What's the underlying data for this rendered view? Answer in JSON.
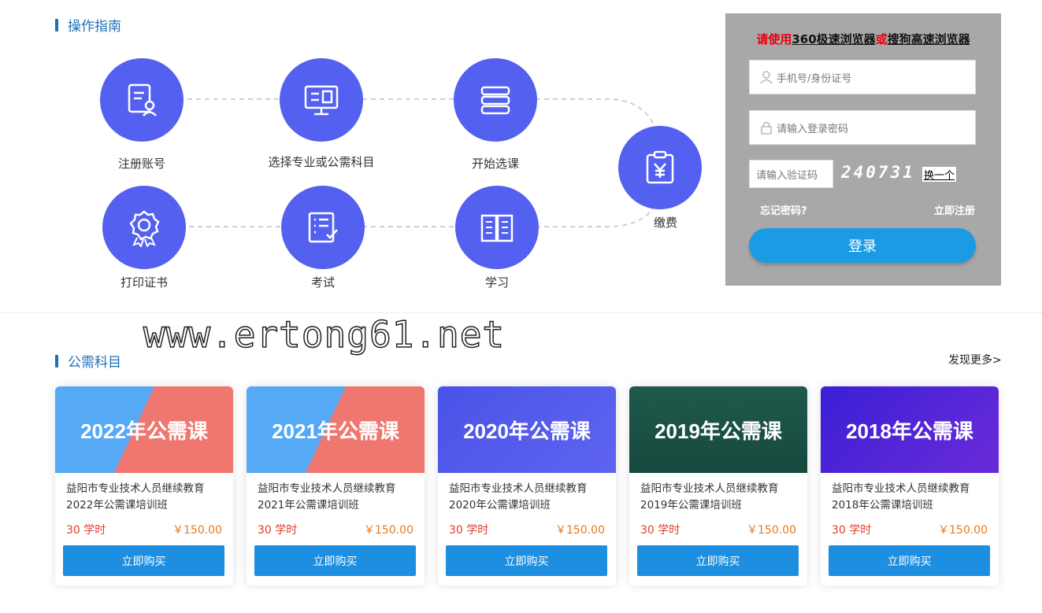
{
  "guide": {
    "title": "操作指南",
    "steps": [
      {
        "label": "注册账号",
        "icon": "register-doc-icon"
      },
      {
        "label": "选择专业或公需科目",
        "icon": "monitor-icon"
      },
      {
        "label": "开始选课",
        "icon": "books-icon"
      },
      {
        "label": "缴费",
        "icon": "clipboard-yen-icon"
      },
      {
        "label": "打印证书",
        "icon": "award-badge-icon"
      },
      {
        "label": "考试",
        "icon": "checklist-icon"
      },
      {
        "label": "学习",
        "icon": "open-book-icon"
      }
    ]
  },
  "login": {
    "note_prefix": "请使用",
    "note_link1": "360极速浏览器",
    "note_mid": "或",
    "note_link2": "搜狗高速浏览器",
    "username_placeholder": "手机号/身份证号",
    "password_placeholder": "请输入登录密码",
    "captcha_placeholder": "请输入验证码",
    "captcha_code": "240731",
    "captcha_swap": "换一个",
    "forgot": "忘记密码?",
    "register": "立即注册",
    "submit": "登录",
    "accent": "#1b9be3"
  },
  "watermark": "www.ertong61.net",
  "courses": {
    "title": "公需科目",
    "more": "发现更多>",
    "items": [
      {
        "banner": "2022年公需课",
        "line1": "益阳市专业技术人员继续教育",
        "line2": "2022年公需课培训班",
        "hours": "30 学时",
        "price": "￥150.00",
        "buy": "立即购买",
        "bg": "linear-gradient(115deg,#56a9f5 0%,#56a9f5 45%,#f0776f 46%,#f0776f 100%)"
      },
      {
        "banner": "2021年公需课",
        "line1": "益阳市专业技术人员继续教育",
        "line2": "2021年公需课培训班",
        "hours": "30 学时",
        "price": "￥150.00",
        "buy": "立即购买",
        "bg": "linear-gradient(115deg,#56a9f5 0%,#56a9f5 45%,#f0776f 46%,#f0776f 100%)"
      },
      {
        "banner": "2020年公需课",
        "line1": "益阳市专业技术人员继续教育",
        "line2": "2020年公需课培训班",
        "hours": "30 学时",
        "price": "￥150.00",
        "buy": "立即购买",
        "bg": "linear-gradient(135deg,#4a53e8,#5e63f0)"
      },
      {
        "banner": "2019年公需课",
        "line1": "益阳市专业技术人员继续教育",
        "line2": "2019年公需课培训班",
        "hours": "30 学时",
        "price": "￥150.00",
        "buy": "立即购买",
        "bg": "linear-gradient(180deg,#1f5a4c,#17483e)"
      },
      {
        "banner": "2018年公需课",
        "line1": "益阳市专业技术人员继续教育",
        "line2": "2018年公需课培训班",
        "hours": "30 学时",
        "price": "￥150.00",
        "buy": "立即购买",
        "bg": "linear-gradient(135deg,#3b1fd6,#6a2bd8)"
      }
    ]
  }
}
